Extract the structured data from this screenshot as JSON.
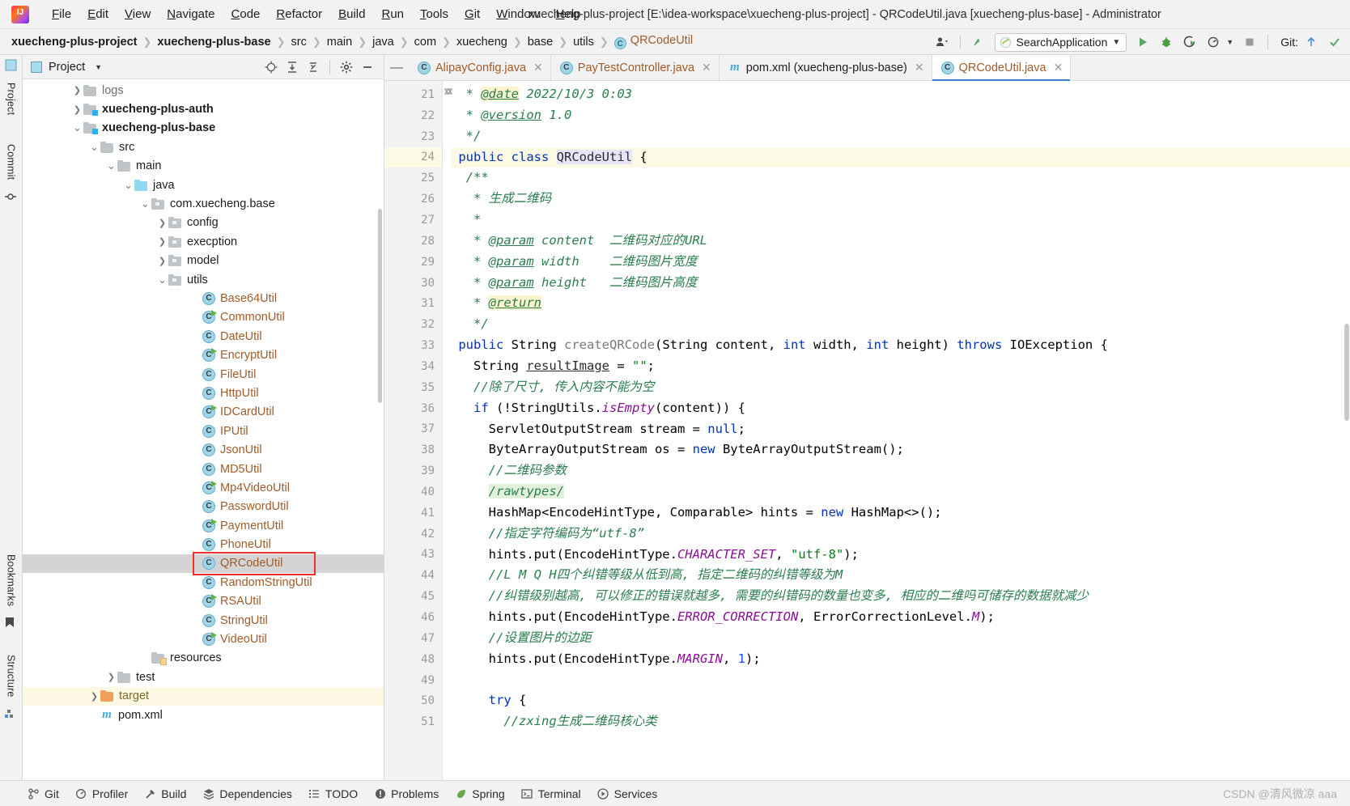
{
  "window": {
    "title": "xuecheng-plus-project [E:\\idea-workspace\\xuecheng-plus-project] - QRCodeUtil.java [xuecheng-plus-base] - Administrator"
  },
  "menubar": {
    "items": [
      {
        "label": "File",
        "mnemonic": "F"
      },
      {
        "label": "Edit",
        "mnemonic": "E"
      },
      {
        "label": "View",
        "mnemonic": "V"
      },
      {
        "label": "Navigate",
        "mnemonic": "N"
      },
      {
        "label": "Code",
        "mnemonic": "C"
      },
      {
        "label": "Refactor",
        "mnemonic": "R"
      },
      {
        "label": "Build",
        "mnemonic": "B"
      },
      {
        "label": "Run",
        "mnemonic": "R"
      },
      {
        "label": "Tools",
        "mnemonic": "T"
      },
      {
        "label": "Git",
        "mnemonic": "G"
      },
      {
        "label": "Window",
        "mnemonic": "W"
      },
      {
        "label": "Help",
        "mnemonic": "H"
      }
    ]
  },
  "navbar": {
    "breadcrumbs": [
      {
        "label": "xuecheng-plus-project",
        "style": "bold"
      },
      {
        "label": "xuecheng-plus-base",
        "style": "bold"
      },
      {
        "label": "src",
        "style": "normal"
      },
      {
        "label": "main",
        "style": "normal"
      },
      {
        "label": "java",
        "style": "normal"
      },
      {
        "label": "com",
        "style": "normal"
      },
      {
        "label": "xuecheng",
        "style": "normal"
      },
      {
        "label": "base",
        "style": "normal"
      },
      {
        "label": "utils",
        "style": "normal"
      },
      {
        "label": "QRCodeUtil",
        "style": "class"
      }
    ],
    "run_configuration": "SearchApplication",
    "git_label": "Git:",
    "icons": [
      "user-icon",
      "updates-icon",
      "run-icon",
      "debug-icon",
      "run-with-coverage-icon",
      "profiler-icon",
      "stop-icon"
    ]
  },
  "project_panel": {
    "title": "Project",
    "toolbar_icons": [
      "locate-icon",
      "expand-all-icon",
      "collapse-all-icon",
      "settings-icon",
      "hide-icon"
    ],
    "tree": [
      {
        "label": "logs",
        "depth": 2,
        "icon": "folder",
        "arrow": "collapsed",
        "style": "dim"
      },
      {
        "label": "xuecheng-plus-auth",
        "depth": 2,
        "icon": "folder-module",
        "arrow": "collapsed",
        "style": "bold"
      },
      {
        "label": "xuecheng-plus-base",
        "depth": 2,
        "icon": "folder-module",
        "arrow": "expanded",
        "style": "bold"
      },
      {
        "label": "src",
        "depth": 3,
        "icon": "folder",
        "arrow": "expanded",
        "style": "normal"
      },
      {
        "label": "main",
        "depth": 4,
        "icon": "folder",
        "arrow": "expanded",
        "style": "normal"
      },
      {
        "label": "java",
        "depth": 5,
        "icon": "folder-source",
        "arrow": "expanded",
        "style": "normal"
      },
      {
        "label": "com.xuecheng.base",
        "depth": 6,
        "icon": "package",
        "arrow": "expanded",
        "style": "normal"
      },
      {
        "label": "config",
        "depth": 7,
        "icon": "package",
        "arrow": "collapsed",
        "style": "normal"
      },
      {
        "label": "execption",
        "depth": 7,
        "icon": "package",
        "arrow": "collapsed",
        "style": "normal"
      },
      {
        "label": "model",
        "depth": 7,
        "icon": "package",
        "arrow": "collapsed",
        "style": "normal"
      },
      {
        "label": "utils",
        "depth": 7,
        "icon": "package",
        "arrow": "expanded",
        "style": "normal"
      },
      {
        "label": "Base64Util",
        "depth": 9,
        "icon": "class",
        "arrow": "none",
        "style": "class"
      },
      {
        "label": "CommonUtil",
        "depth": 9,
        "icon": "class-runnable",
        "arrow": "none",
        "style": "class"
      },
      {
        "label": "DateUtil",
        "depth": 9,
        "icon": "class",
        "arrow": "none",
        "style": "class"
      },
      {
        "label": "EncryptUtil",
        "depth": 9,
        "icon": "class-runnable",
        "arrow": "none",
        "style": "class"
      },
      {
        "label": "FileUtil",
        "depth": 9,
        "icon": "class",
        "arrow": "none",
        "style": "class"
      },
      {
        "label": "HttpUtil",
        "depth": 9,
        "icon": "class",
        "arrow": "none",
        "style": "class"
      },
      {
        "label": "IDCardUtil",
        "depth": 9,
        "icon": "class-runnable",
        "arrow": "none",
        "style": "class"
      },
      {
        "label": "IPUtil",
        "depth": 9,
        "icon": "class",
        "arrow": "none",
        "style": "class"
      },
      {
        "label": "JsonUtil",
        "depth": 9,
        "icon": "class",
        "arrow": "none",
        "style": "class"
      },
      {
        "label": "MD5Util",
        "depth": 9,
        "icon": "class",
        "arrow": "none",
        "style": "class"
      },
      {
        "label": "Mp4VideoUtil",
        "depth": 9,
        "icon": "class-runnable",
        "arrow": "none",
        "style": "class"
      },
      {
        "label": "PasswordUtil",
        "depth": 9,
        "icon": "class",
        "arrow": "none",
        "style": "class"
      },
      {
        "label": "PaymentUtil",
        "depth": 9,
        "icon": "class-runnable",
        "arrow": "none",
        "style": "class"
      },
      {
        "label": "PhoneUtil",
        "depth": 9,
        "icon": "class",
        "arrow": "none",
        "style": "class"
      },
      {
        "label": "QRCodeUtil",
        "depth": 9,
        "icon": "class",
        "arrow": "none",
        "style": "class",
        "selected": true,
        "annotated": true
      },
      {
        "label": "RandomStringUtil",
        "depth": 9,
        "icon": "class",
        "arrow": "none",
        "style": "class"
      },
      {
        "label": "RSAUtil",
        "depth": 9,
        "icon": "class-runnable",
        "arrow": "none",
        "style": "class"
      },
      {
        "label": "StringUtil",
        "depth": 9,
        "icon": "class",
        "arrow": "none",
        "style": "class"
      },
      {
        "label": "VideoUtil",
        "depth": 9,
        "icon": "class-runnable",
        "arrow": "none",
        "style": "class"
      },
      {
        "label": "resources",
        "depth": 6,
        "icon": "folder-resources",
        "arrow": "none",
        "style": "normal"
      },
      {
        "label": "test",
        "depth": 4,
        "icon": "folder",
        "arrow": "collapsed",
        "style": "normal"
      },
      {
        "label": "target",
        "depth": 3,
        "icon": "folder-target",
        "arrow": "collapsed",
        "style": "target",
        "highlight": true
      },
      {
        "label": "pom.xml",
        "depth": 3,
        "icon": "maven",
        "arrow": "none",
        "style": "normal"
      }
    ]
  },
  "left_rail": {
    "tabs": [
      "Project",
      "Commit",
      "Bookmarks",
      "Structure"
    ]
  },
  "editor_tabs": [
    {
      "label": "AlipayConfig.java",
      "icon": "class-icon",
      "active": false
    },
    {
      "label": "PayTestController.java",
      "icon": "class-icon",
      "active": false
    },
    {
      "label": "pom.xml (xuecheng-plus-base)",
      "icon": "maven-icon",
      "active": false
    },
    {
      "label": "QRCodeUtil.java",
      "icon": "class-icon",
      "active": true
    }
  ],
  "editor": {
    "first_line": 21,
    "current_line": 24,
    "lines": [
      {
        "n": 21,
        "fold": "",
        "html": "  <span class='doc'>* </span><span class='doctag hlt'>@date</span><span class='doc'> 2022/10/3 0:03</span>"
      },
      {
        "n": 22,
        "fold": "",
        "html": "  <span class='doc'>* </span><span class='doctag'>@version</span><span class='doc'> 1.0</span>"
      },
      {
        "n": 23,
        "fold": "end",
        "html": "  <span class='doc'>*/</span>"
      },
      {
        "n": 24,
        "fold": "",
        "current": true,
        "html": " <span class='k'>public class</span> <span class='cls-hl'>QRCodeUtil</span> {"
      },
      {
        "n": 25,
        "fold": "start",
        "html": "  <span class='doc'>/**</span>"
      },
      {
        "n": 26,
        "fold": "",
        "html": "   <span class='doc'>* 生成二维码</span>"
      },
      {
        "n": 27,
        "fold": "",
        "html": "   <span class='doc'>*</span>"
      },
      {
        "n": 28,
        "fold": "",
        "html": "   <span class='doc'>* </span><span class='doctag'>@param</span><span class='doc'> content  二维码对应的URL</span>"
      },
      {
        "n": 29,
        "fold": "",
        "html": "   <span class='doc'>* </span><span class='doctag'>@param</span><span class='doc'> width    二维码图片宽度</span>"
      },
      {
        "n": 30,
        "fold": "",
        "html": "   <span class='doc'>* </span><span class='doctag'>@param</span><span class='doc'> height   二维码图片高度</span>"
      },
      {
        "n": 31,
        "fold": "",
        "html": "   <span class='doc'>* </span><span class='doctag hlt'>@return</span>"
      },
      {
        "n": 32,
        "fold": "end",
        "html": "   <span class='doc'>*/</span>"
      },
      {
        "n": 33,
        "fold": "start",
        "html": " <span class='k'>public</span> String <span class='meth'>createQRCode</span>(String content, <span class='k'>int</span> width, <span class='k'>int</span> height) <span class='k'>throws</span> IOException {"
      },
      {
        "n": 34,
        "fold": "",
        "html": "   String <span class='field'>resultImage</span> = <span class='str'>\"\"</span>;"
      },
      {
        "n": 35,
        "fold": "",
        "html": "   <span class='cmt doc'>//除了尺寸, 传入内容不能为空</span>"
      },
      {
        "n": 36,
        "fold": "start",
        "html": "   <span class='k'>if</span> (!StringUtils.<span class='stat'>isEmpty</span>(content)) {"
      },
      {
        "n": 37,
        "fold": "",
        "html": "     ServletOutputStream stream = <span class='k'>null</span>;"
      },
      {
        "n": 38,
        "fold": "",
        "html": "     ByteArrayOutputStream os = <span class='k'>new</span> ByteArrayOutputStream();"
      },
      {
        "n": 39,
        "fold": "",
        "html": "     <span class='cmt doc'>//二维码参数</span>"
      },
      {
        "n": 40,
        "fold": "",
        "html": "     <span class='ann-hl cmt doc'>/rawtypes/</span>"
      },
      {
        "n": 41,
        "fold": "",
        "html": "     HashMap&lt;EncodeHintType, Comparable&gt; hints = <span class='k'>new</span> HashMap&lt;&gt;();"
      },
      {
        "n": 42,
        "fold": "",
        "html": "     <span class='cmt doc'>//指定字符编码为“utf-8”</span>"
      },
      {
        "n": 43,
        "fold": "",
        "html": "     hints.put(EncodeHintType.<span class='stat'>CHARACTER_SET</span>, <span class='str'>\"utf-8\"</span>);"
      },
      {
        "n": 44,
        "fold": "start",
        "html": "     <span class='cmt doc'>//L M Q H四个纠错等级从低到高, 指定二维码的纠错等级为M</span>"
      },
      {
        "n": 45,
        "fold": "end",
        "html": "     <span class='cmt doc'>//纠错级别越高, 可以修正的错误就越多, 需要的纠错码的数量也变多, 相应的二维吗可储存的数据就减少</span>"
      },
      {
        "n": 46,
        "fold": "",
        "html": "     hints.put(EncodeHintType.<span class='stat'>ERROR_CORRECTION</span>, ErrorCorrectionLevel.<span class='stat'>M</span>);"
      },
      {
        "n": 47,
        "fold": "",
        "html": "     <span class='cmt doc'>//设置图片的边距</span>"
      },
      {
        "n": 48,
        "fold": "",
        "html": "     hints.put(EncodeHintType.<span class='stat'>MARGIN</span>, <span class='num'>1</span>);"
      },
      {
        "n": 49,
        "fold": "",
        "html": ""
      },
      {
        "n": 50,
        "fold": "start",
        "html": "     <span class='k'>try</span> {"
      },
      {
        "n": 51,
        "fold": "",
        "html": "       <span class='cmt doc'>//zxing生成二维码核心类</span>"
      }
    ]
  },
  "statusbar": {
    "items": [
      {
        "label": "Git",
        "icon": "git-branch-icon"
      },
      {
        "label": "Profiler",
        "icon": "profiler-icon"
      },
      {
        "label": "Build",
        "icon": "build-hammer-icon"
      },
      {
        "label": "Dependencies",
        "icon": "dependencies-icon"
      },
      {
        "label": "TODO",
        "icon": "todo-list-icon"
      },
      {
        "label": "Problems",
        "icon": "problems-icon"
      },
      {
        "label": "Spring",
        "icon": "spring-leaf-icon"
      },
      {
        "label": "Terminal",
        "icon": "terminal-icon"
      },
      {
        "label": "Services",
        "icon": "services-icon"
      }
    ],
    "watermark": "CSDN @清风微凉 aaa"
  },
  "colors": {
    "accent_blue": "#3d7fd0",
    "selection_gray": "#d4d4d4",
    "annotation_red": "#e8312a",
    "class_orange": "#9f5c2b",
    "highlight_yellow": "#fdf8e3",
    "current_line": "#fcfae4"
  }
}
